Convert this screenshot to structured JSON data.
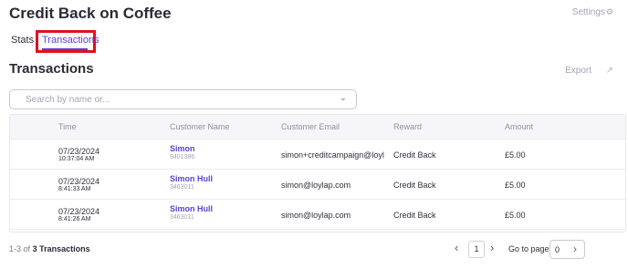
{
  "header": {
    "title": "Credit Back on Coffee",
    "settings_label": "Settings",
    "settings_icon": "gear-icon"
  },
  "tabs": [
    {
      "label": "Stats"
    },
    {
      "label": "Transactions",
      "active": true
    }
  ],
  "section": {
    "title": "Transactions",
    "export_label": "Export",
    "export_icon": "external-link-icon"
  },
  "search": {
    "placeholder": "Search by name or...",
    "value": ""
  },
  "table": {
    "columns": [
      "Time",
      "Customer Name",
      "Customer Email",
      "Reward",
      "Amount"
    ],
    "rows": [
      {
        "date": "07/23/2024",
        "time": "10:37:04 AM",
        "name": "Simon",
        "id": "9401386",
        "email": "simon+creditcampaign@loylap.c",
        "reward": "Credit Back",
        "amount": "£5.00"
      },
      {
        "date": "07/23/2024",
        "time": "8:41:33 AM",
        "name": "Simon Hull",
        "id": "3463011",
        "email": "simon@loylap.com",
        "reward": "Credit Back",
        "amount": "£5.00"
      },
      {
        "date": "07/23/2024",
        "time": "8:41:26 AM",
        "name": "Simon Hull",
        "id": "3463011",
        "email": "simon@loylap.com",
        "reward": "Credit Back",
        "amount": "£5.00"
      }
    ]
  },
  "footer": {
    "range": "1-3",
    "of": "of",
    "total": "3 Transactions",
    "current_page": "1",
    "goto_label": "Go to page",
    "goto_value": "0"
  },
  "colors": {
    "accent": "#5b3fd1",
    "highlight_box": "#e0101c"
  }
}
